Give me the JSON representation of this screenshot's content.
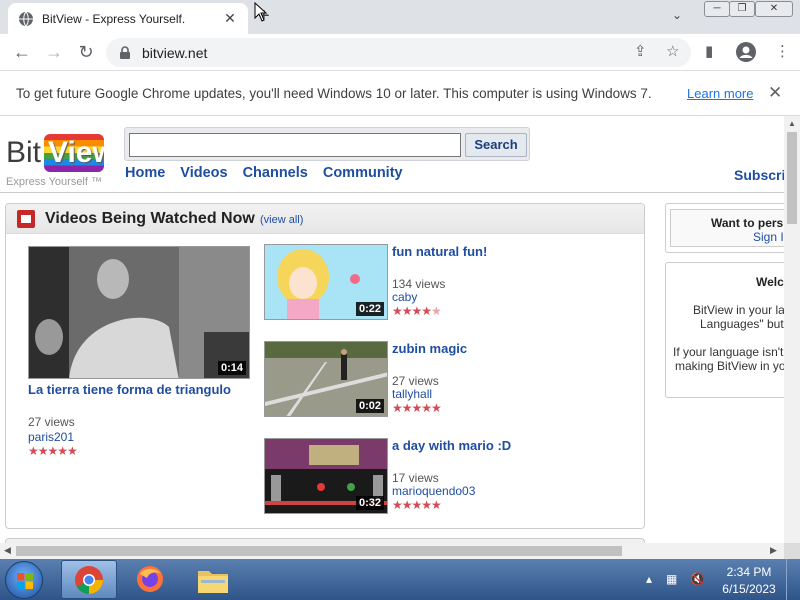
{
  "browser": {
    "tab_title": "BitView - Express Yourself.",
    "tab_close": "✕",
    "new_tab": "+",
    "url": "bitview.net"
  },
  "infobar": {
    "message": "To get future Google Chrome updates, you'll need Windows 10 or later. This computer is using Windows 7.",
    "learn_more": "Learn more",
    "close": "✕"
  },
  "site": {
    "logo_bit": "Bit",
    "logo_view": "View",
    "tagline": "Express Yourself ™",
    "search_button": "Search",
    "search_value": "",
    "nav": [
      "Home",
      "Videos",
      "Channels",
      "Community"
    ],
    "subscribe": "Subscrip"
  },
  "watched": {
    "title": "Videos Being Watched Now",
    "view_all": "(view all)",
    "featured": {
      "title": "La tierra tiene forma de triangulo",
      "duration": "0:14",
      "views": "27 views",
      "user": "paris201",
      "rating": 5
    },
    "videos": [
      {
        "title": "fun natural fun!",
        "duration": "0:22",
        "views": "134 views",
        "user": "caby",
        "rating": 4.5
      },
      {
        "title": "zubin magic",
        "duration": "0:02",
        "views": "27 views",
        "user": "tallyhall",
        "rating": 5
      },
      {
        "title": "a day with mario :D",
        "duration": "0:32",
        "views": "17 views",
        "user": "marioquendo03",
        "rating": 5
      }
    ]
  },
  "sidebar": {
    "box1_text": "Want to pers",
    "box1_link": "Sign I",
    "box2_title": "Welc",
    "box2_lines": [
      "BitView in your la",
      "Languages\" but",
      "If your language isn't",
      "making BitView in yo"
    ]
  },
  "taskbar": {
    "time": "2:34 PM",
    "date": "6/15/2023"
  },
  "colors": {
    "link": "#1f4ea1",
    "star": "#d24b57",
    "chrome_accent": "#1a73e8"
  }
}
